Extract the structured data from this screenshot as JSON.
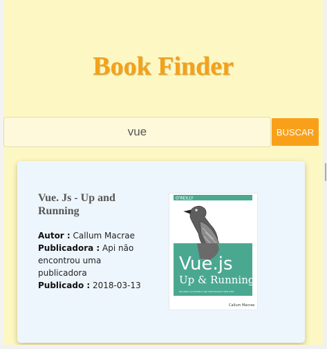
{
  "header": {
    "title": "Book Finder"
  },
  "search": {
    "value": "vue",
    "button_label": "BUSCAR"
  },
  "results": [
    {
      "title": "Vue. Js - Up and Running",
      "author_label": "Autor :",
      "author": "Callum Macrae",
      "publisher_label": "Publicadora :",
      "publisher": "Api não encontrou uma publicadora",
      "published_label": "Publicado :",
      "published": "2018-03-13",
      "cover": {
        "brand": "O'REILLY",
        "title_line1": "Vue.js",
        "title_line2": "Up & Running",
        "subtitle": "BUILDING ACCESSIBLE AND PERFORMANT WEB APPS",
        "author": "Callum Macrae",
        "accent_color": "#4aa891"
      }
    }
  ],
  "colors": {
    "page_background": "#fdf8c3",
    "title": "#f4a11a",
    "button": "#f9a01b",
    "card": "#eef6fd"
  }
}
